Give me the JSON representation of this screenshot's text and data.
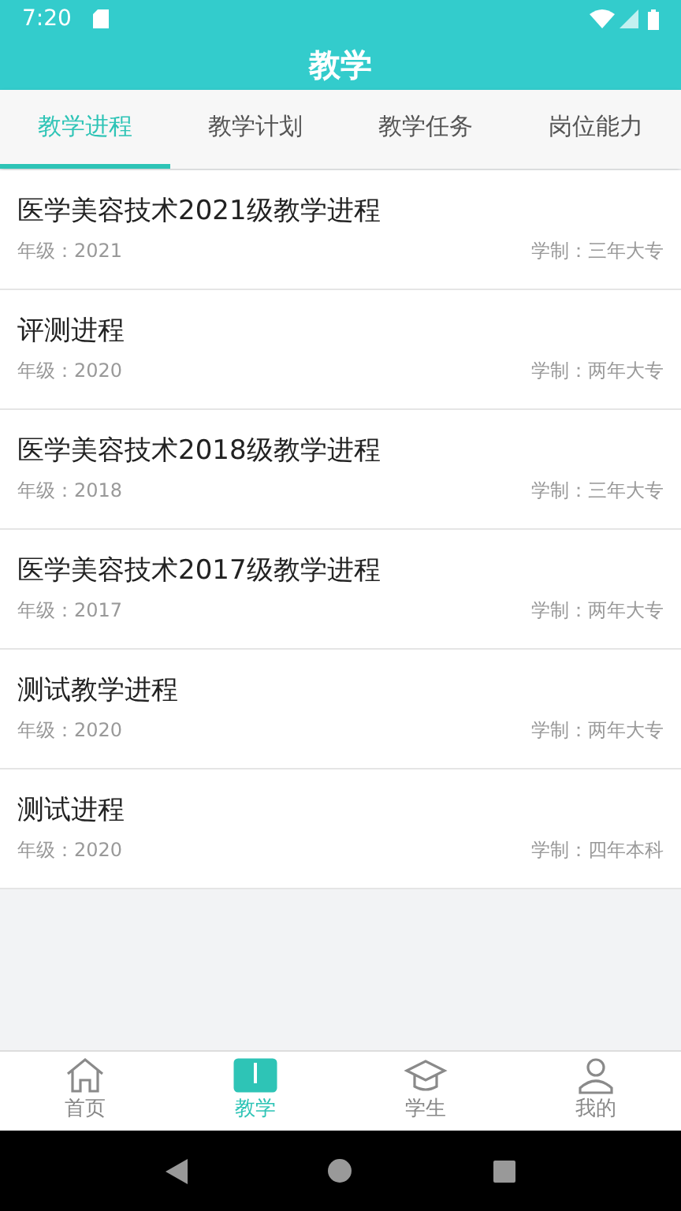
{
  "status_bar": {
    "time": "7:20"
  },
  "header": {
    "title": "教学"
  },
  "tabs": [
    {
      "label": "教学进程",
      "selected": true
    },
    {
      "label": "教学计划",
      "selected": false
    },
    {
      "label": "教学任务",
      "selected": false
    },
    {
      "label": "岗位能力",
      "selected": false
    }
  ],
  "items": [
    {
      "title": "医学美容技术2021级教学进程",
      "grade": "年级：2021",
      "system": "学制：三年大专"
    },
    {
      "title": "评测进程",
      "grade": "年级：2020",
      "system": "学制：两年大专"
    },
    {
      "title": "医学美容技术2018级教学进程",
      "grade": "年级：2018",
      "system": "学制：三年大专"
    },
    {
      "title": "医学美容技术2017级教学进程",
      "grade": "年级：2017",
      "system": "学制：两年大专"
    },
    {
      "title": "测试教学进程",
      "grade": "年级：2020",
      "system": "学制：两年大专"
    },
    {
      "title": "测试进程",
      "grade": "年级：2020",
      "system": "学制：四年本科"
    }
  ],
  "bottom_nav": [
    {
      "label": "首页",
      "kind": "home",
      "selected": false
    },
    {
      "label": "教学",
      "kind": "book",
      "selected": true
    },
    {
      "label": "学生",
      "kind": "cap",
      "selected": false
    },
    {
      "label": "我的",
      "kind": "user",
      "selected": false
    }
  ]
}
